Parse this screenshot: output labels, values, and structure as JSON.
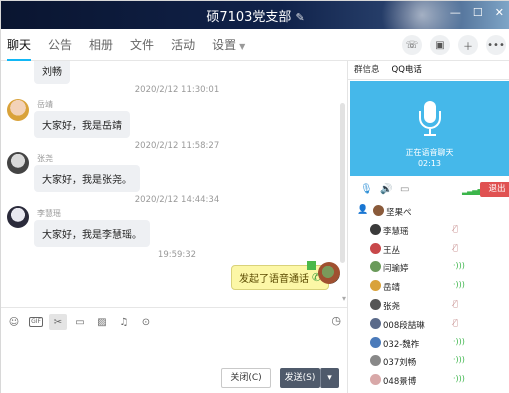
{
  "window": {
    "title": "硕7103党支部",
    "edit_icon": "pencil-icon"
  },
  "tabs": [
    {
      "label": "聊天",
      "active": true
    },
    {
      "label": "公告"
    },
    {
      "label": "相册"
    },
    {
      "label": "文件"
    },
    {
      "label": "活动"
    },
    {
      "label": "设置"
    }
  ],
  "chat": {
    "top_fragment": "刘畅",
    "messages": [
      {
        "time": "2020/2/12 11:30:01",
        "sender": "岳靖",
        "text": "大家好，我是岳靖"
      },
      {
        "time": "2020/2/12 11:58:27",
        "sender": "张尧",
        "text": "大家好，我是张尧。"
      },
      {
        "time": "2020/2/12 14:44:34",
        "sender": "李慧瑶",
        "text": "大家好，我是李慧瑶。"
      }
    ],
    "call_time": "19:59:32",
    "call_text": "发起了语音通话"
  },
  "input": {
    "close_label": "关闭(C)",
    "send_label": "发送(S)",
    "send_options": "▾"
  },
  "right": {
    "tabs": [
      "群信息",
      "QQ电话"
    ],
    "voice_status": "正在语音聊天",
    "voice_time": "02:13",
    "exit_label": "退出",
    "members": [
      {
        "name": "坚果ぺ",
        "status": "host",
        "color": "#8a5a3a"
      },
      {
        "name": "李慧瑶",
        "status": "muted",
        "color": "#3a3a3a"
      },
      {
        "name": "王丛",
        "status": "muted",
        "color": "#c8484a"
      },
      {
        "name": "闫瑜婷",
        "status": "on",
        "color": "#6a9a5a"
      },
      {
        "name": "岳靖",
        "status": "on",
        "color": "#d9a23a"
      },
      {
        "name": "张尧",
        "status": "muted",
        "color": "#555555"
      },
      {
        "name": "008段喆琳",
        "status": "muted",
        "color": "#5a6a8a"
      },
      {
        "name": "032-魏祚",
        "status": "on",
        "color": "#4a7aba"
      },
      {
        "name": "037刘畅",
        "status": "on",
        "color": "#888888"
      },
      {
        "name": "048景博",
        "status": "on",
        "color": "#d8a8a8"
      }
    ]
  }
}
